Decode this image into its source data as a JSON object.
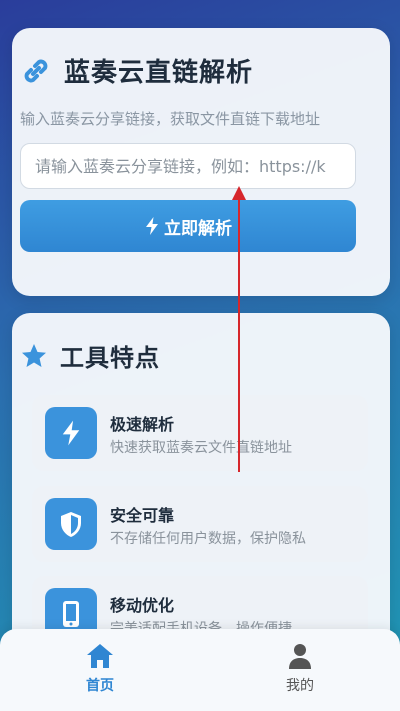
{
  "parse_card": {
    "title": "蓝奏云直链解析",
    "subtitle": "输入蓝奏云分享链接，获取文件直链下载地址",
    "input_placeholder": "请输入蓝奏云分享链接，例如：https://k",
    "input_value": "",
    "button_label": "立即解析"
  },
  "features_card": {
    "title": "工具特点",
    "items": [
      {
        "title": "极速解析",
        "desc": "快速获取蓝奏云文件直链地址",
        "icon": "bolt-icon"
      },
      {
        "title": "安全可靠",
        "desc": "不存储任何用户数据，保护隐私",
        "icon": "shield-icon"
      },
      {
        "title": "移动优化",
        "desc": "完美适配手机设备，操作便捷",
        "icon": "phone-icon"
      }
    ]
  },
  "bottom_nav": {
    "items": [
      {
        "label": "首页",
        "icon": "home-icon",
        "active": true
      },
      {
        "label": "我的",
        "icon": "user-icon",
        "active": false
      }
    ]
  },
  "colors": {
    "accent": "#2f86d2",
    "icon_bg": "#3b93dc",
    "annotation_arrow": "#d6262b"
  }
}
